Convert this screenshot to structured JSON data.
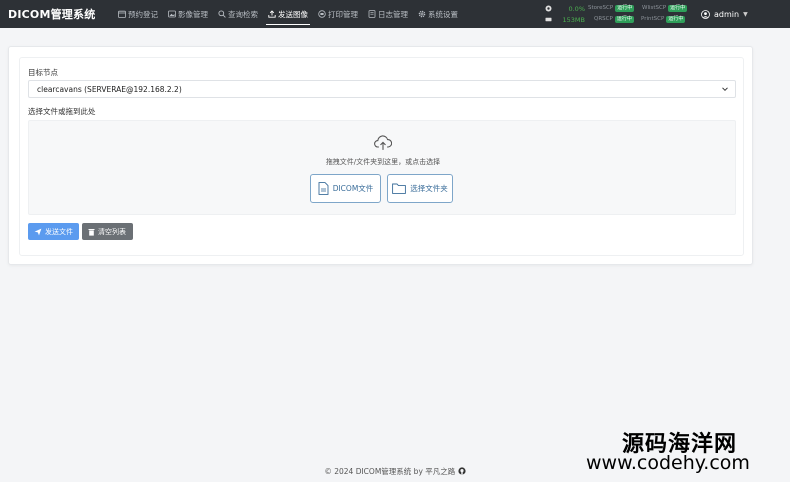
{
  "app": {
    "title": "DICOM管理系统"
  },
  "nav": {
    "items": [
      {
        "label": "预约登记",
        "icon": "calendar-icon",
        "active": false
      },
      {
        "label": "影像管理",
        "icon": "image-icon",
        "active": false
      },
      {
        "label": "查询检索",
        "icon": "search-icon",
        "active": false
      },
      {
        "label": "发送图像",
        "icon": "upload-icon",
        "active": true
      },
      {
        "label": "打印管理",
        "icon": "print-icon",
        "active": false
      },
      {
        "label": "日志管理",
        "icon": "log-icon",
        "active": false
      },
      {
        "label": "系统设置",
        "icon": "gear-icon",
        "active": false
      }
    ]
  },
  "status": {
    "cpu": "0.0%",
    "memory": "153MB",
    "services": [
      {
        "name": "StoreSCP",
        "state": "运行中"
      },
      {
        "name": "WlistSCP",
        "state": "运行中"
      },
      {
        "name": "QRSCP",
        "state": "运行中"
      },
      {
        "name": "PrintSCP",
        "state": "运行中"
      }
    ],
    "badge_color": "#2e9e59"
  },
  "user": {
    "name": "admin"
  },
  "form": {
    "target_label": "目标节点",
    "target_value": "clearcavans (SERVERAE@192.168.2.2)",
    "file_label": "选择文件或拖到此处",
    "dropzone_text": "拖拽文件/文件夹到这里，或点击选择",
    "dicom_button": "DICOM文件",
    "folder_button": "选择文件夹",
    "send_button": "发送文件",
    "clear_button": "清空列表"
  },
  "footer": {
    "text": "© 2024 DICOM管理系统 by 平凡之路"
  },
  "watermark": {
    "cn": "源码海洋网",
    "url": "www.codehy.com"
  },
  "colors": {
    "navbar": "#2d3136",
    "primary": "#5b9bef",
    "secondary": "#6b7075",
    "accent": "#3a6d9a"
  }
}
